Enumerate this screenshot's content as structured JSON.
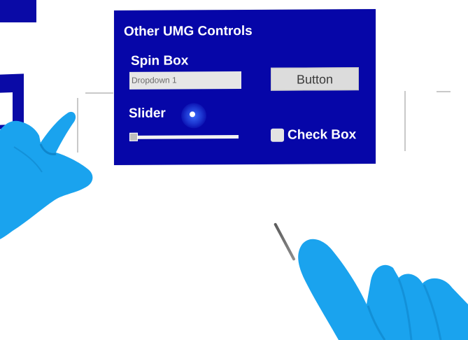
{
  "panel": {
    "title": "Other UMG Controls"
  },
  "spin_box": {
    "label": "Spin Box",
    "value": "Dropdown 1"
  },
  "button": {
    "label": "Button"
  },
  "slider": {
    "label": "Slider",
    "value": 0
  },
  "checkbox": {
    "label": "Check Box",
    "checked": false
  },
  "colors": {
    "panel": "#0606a8",
    "hand": "#1aa3ee",
    "background": "#ffffff"
  },
  "icons": {
    "left_hand": "left-hand-icon",
    "right_hand": "right-hand-icon",
    "pointer": "pointer-ray-icon"
  }
}
